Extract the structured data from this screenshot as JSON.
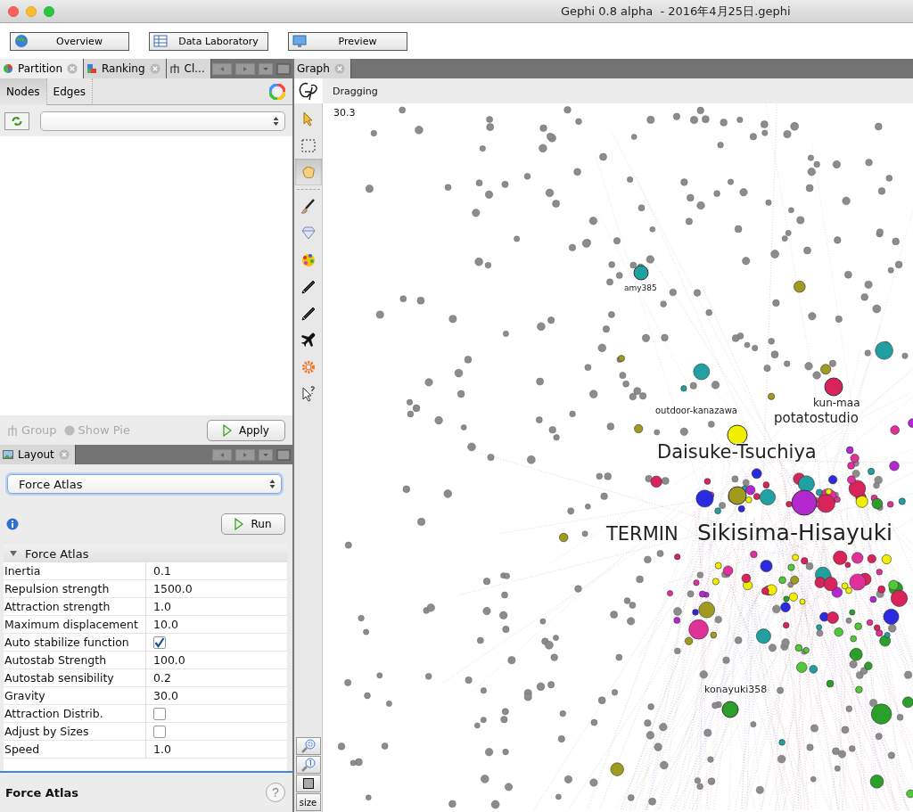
{
  "window": {
    "title": "Gephi 0.8 alpha  - 2016年4月25日.gephi"
  },
  "toolbar": {
    "buttons": [
      {
        "label": "Overview",
        "kind": "globe"
      },
      {
        "label": "Data Laboratory",
        "kind": "table"
      },
      {
        "label": "Preview",
        "kind": "monitor"
      }
    ]
  },
  "partition_panel": {
    "tabs": [
      {
        "label": "Partition",
        "selected": true,
        "kind": "partition"
      },
      {
        "label": "Ranking",
        "selected": false,
        "kind": "ranking"
      },
      {
        "label": "Cl...",
        "selected": false,
        "kind": "cluster"
      }
    ],
    "subtabs": [
      {
        "label": "Nodes",
        "selected": true
      },
      {
        "label": "Edges",
        "selected": false
      }
    ],
    "group": {
      "label": "Group",
      "disabled": true
    },
    "show_pie": {
      "label": "Show Pie",
      "disabled": true
    },
    "apply": "Apply"
  },
  "layout_panel": {
    "tab": "Layout",
    "algorithm": "Force Atlas",
    "run": "Run",
    "section": {
      "title": "Force Atlas",
      "expanded": true
    },
    "properties": [
      {
        "name": "Inertia",
        "kind": "text",
        "value": "0.1"
      },
      {
        "name": "Repulsion strength",
        "kind": "text",
        "value": "1500.0"
      },
      {
        "name": "Attraction strength",
        "kind": "text",
        "value": "1.0"
      },
      {
        "name": "Maximum displacement",
        "kind": "text",
        "value": "10.0"
      },
      {
        "name": "Auto stabilize function",
        "kind": "checkbox",
        "checked": true
      },
      {
        "name": "Autostab Strength",
        "kind": "text",
        "value": "100.0"
      },
      {
        "name": "Autostab sensibility",
        "kind": "text",
        "value": "0.2"
      },
      {
        "name": "Gravity",
        "kind": "text",
        "value": "30.0"
      },
      {
        "name": "Attraction Distrib.",
        "kind": "checkbox",
        "checked": false
      },
      {
        "name": "Adjust by Sizes",
        "kind": "checkbox",
        "checked": false
      },
      {
        "name": "Speed",
        "kind": "text",
        "value": "1.0"
      }
    ],
    "footer": {
      "title": "Force Atlas",
      "help": "?"
    }
  },
  "graph_panel": {
    "tab": "Graph",
    "mode": "Dragging",
    "zoom_reading": "30.3",
    "tools": [
      {
        "kind": "pointer",
        "selected": false
      },
      {
        "kind": "rectangle",
        "selected": false
      },
      {
        "kind": "hand",
        "selected": true
      },
      {
        "kind": "brush",
        "selected": false
      },
      {
        "kind": "diamond",
        "selected": false
      },
      {
        "kind": "palette",
        "selected": false
      },
      {
        "kind": "pencil",
        "selected": false
      },
      {
        "kind": "pencil",
        "selected": false
      },
      {
        "kind": "airplane",
        "selected": false
      },
      {
        "kind": "gear",
        "selected": false
      },
      {
        "kind": "help-pointer",
        "selected": false
      }
    ],
    "size_button": "size",
    "node_labels": [
      {
        "text": "amy385"
      },
      {
        "text": "kun-maa"
      },
      {
        "text": "potatostudio"
      },
      {
        "text": "outdoor-kanazawa"
      },
      {
        "text": "Daisuke-Tsuchiya"
      },
      {
        "text": "TERMIN"
      },
      {
        "text": "Sikisima-Hisayuki"
      },
      {
        "text": "konayuki358"
      }
    ]
  }
}
